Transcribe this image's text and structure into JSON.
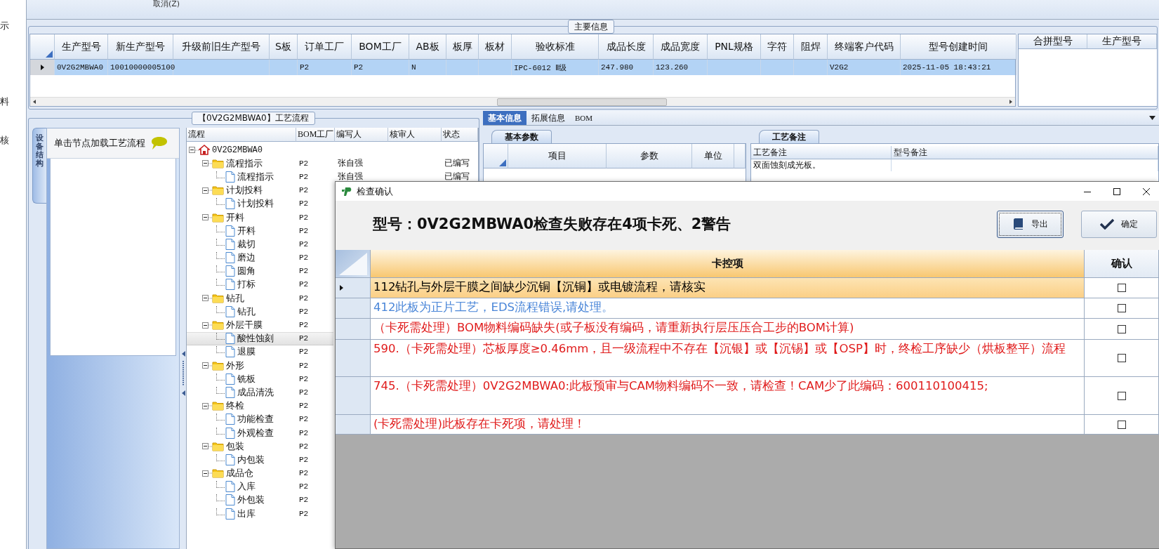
{
  "left_nav": {
    "items": [
      {
        "label": "示"
      },
      {
        "label": "料"
      },
      {
        "label": "核"
      }
    ]
  },
  "toolbar": {
    "items": [
      {
        "label": "取消(Z)"
      }
    ]
  },
  "main_info": {
    "title": "主要信息",
    "columns": [
      "生产型号",
      "新生产型号",
      "升级前旧生产型号",
      "S板",
      "订单工厂",
      "BOM工厂",
      "AB板",
      "板厚",
      "板材",
      "验收标准",
      "成品长度",
      "成品宽度",
      "PNL规格",
      "字符",
      "阻焊",
      "终端客户代码",
      "型号创建时间"
    ],
    "rows": [
      {
        "selected": true,
        "cells": [
          "0V2G2MBWA0",
          "10010000005100",
          null,
          null,
          "P2",
          "P2",
          "N",
          null,
          null,
          "IPC-6012 Ⅱ级",
          "247.980",
          "123.260",
          null,
          null,
          null,
          "V2G2",
          "2025-11-05 18:43:21"
        ]
      }
    ],
    "merge_columns": [
      "合拼型号",
      "生产型号"
    ]
  },
  "process_flow": {
    "title": "【0V2G2MBWA0】工艺流程",
    "side_tab": "设备结构",
    "hint": "单击节点加载工艺流程",
    "columns": [
      "流程",
      "BOM工厂",
      "编写人",
      "核审人",
      "状态"
    ],
    "nodes": [
      {
        "label": "0V2G2MBWA0",
        "expanded": true,
        "selected": false,
        "children": [
          {
            "label": "流程指示",
            "bom": "P2",
            "writer": "张自强",
            "status": "已编写",
            "expanded": true,
            "selected": false,
            "children": [
              {
                "label": "流程指示",
                "bom": "P2",
                "writer": "张自强",
                "status": "已编写",
                "selected": false
              }
            ]
          },
          {
            "label": "计划投料",
            "bom": "P2",
            "expanded": true,
            "selected": false,
            "children": [
              {
                "label": "计划投料",
                "bom": "P2",
                "selected": false
              }
            ]
          },
          {
            "label": "开料",
            "bom": "P2",
            "expanded": true,
            "selected": false,
            "children": [
              {
                "label": "开料",
                "bom": "P2",
                "selected": false
              },
              {
                "label": "裁切",
                "bom": "P2",
                "selected": false
              },
              {
                "label": "磨边",
                "bom": "P2",
                "selected": false
              },
              {
                "label": "圆角",
                "bom": "P2",
                "selected": false
              },
              {
                "label": "打标",
                "bom": "P2",
                "selected": false
              }
            ]
          },
          {
            "label": "钻孔",
            "bom": "P2",
            "expanded": true,
            "selected": false,
            "children": [
              {
                "label": "钻孔",
                "bom": "P2",
                "selected": false
              }
            ]
          },
          {
            "label": "外层干膜",
            "bom": "P2",
            "expanded": true,
            "selected": false,
            "children": [
              {
                "label": "酸性蚀刻",
                "bom": "P2",
                "selected": true
              },
              {
                "label": "退膜",
                "bom": "P2",
                "selected": false
              }
            ]
          },
          {
            "label": "外形",
            "bom": "P2",
            "expanded": true,
            "selected": false,
            "children": [
              {
                "label": "铣板",
                "bom": "P2",
                "selected": false
              },
              {
                "label": "成品清洗",
                "bom": "P2",
                "selected": false
              }
            ]
          },
          {
            "label": "终检",
            "bom": "P2",
            "expanded": true,
            "selected": false,
            "children": [
              {
                "label": "功能检查",
                "bom": "P2",
                "selected": false
              },
              {
                "label": "外观检查",
                "bom": "P2",
                "selected": false
              }
            ]
          },
          {
            "label": "包装",
            "bom": "P2",
            "expanded": true,
            "selected": false,
            "children": [
              {
                "label": "内包装",
                "bom": "P2",
                "selected": false
              }
            ]
          },
          {
            "label": "成品仓",
            "bom": "P2",
            "expanded": true,
            "selected": false,
            "children": [
              {
                "label": "入库",
                "bom": "P2",
                "selected": false
              },
              {
                "label": "外包装",
                "bom": "P2",
                "selected": false
              },
              {
                "label": "出库",
                "bom": "P2",
                "selected": false
              }
            ]
          }
        ]
      }
    ]
  },
  "info_panel": {
    "tabs": [
      {
        "label": "基本信息",
        "selected": true
      },
      {
        "label": "拓展信息",
        "selected": false
      },
      {
        "label": "BOM",
        "selected": false
      }
    ],
    "basic_params": {
      "title": "基本参数",
      "columns": [
        "项目",
        "参数",
        "单位"
      ]
    },
    "process_notes": {
      "title": "工艺备注",
      "columns": [
        "工艺备注",
        "型号备注"
      ],
      "rows": [
        {
          "process_note": "双面蚀刻成光板。"
        }
      ]
    }
  },
  "dialog": {
    "title": "检查确认",
    "heading": "型号：0V2G2MBWA0检查失败存在4项卡死、2警告",
    "buttons": [
      {
        "label": "导出",
        "kind": "export"
      },
      {
        "label": "确定",
        "kind": "confirm"
      }
    ],
    "columns": [
      "卡控项",
      "确认"
    ],
    "rows": [
      {
        "text": "112钻孔与外层干膜之间缺少沉铜【沉铜】或电镀流程，请核实",
        "color": "#000000",
        "checked": false,
        "selected": true
      },
      {
        "text": "412此板为正片工艺，EDS流程错误,请处理。",
        "color": "#4a86d8",
        "checked": false,
        "selected": false
      },
      {
        "text": "（卡死需处理）BOM物料编码缺失(或子板没有编码，请重新执行层压压合工步的BOM计算)",
        "color": "#e01b1b",
        "checked": false,
        "selected": false
      },
      {
        "text": "590.（卡死需处理）芯板厚度≥0.46mm，且一级流程中不存在【沉银】或【沉锡】或【OSP】时，终检工序缺少（烘板整平）流程",
        "color": "#e01b1b",
        "checked": false,
        "selected": false
      },
      {
        "text": "745.（卡死需处理）0V2G2MBWA0:此板预审与CAM物料编码不一致，请检查！CAM少了此编码：600110100415;",
        "color": "#e01b1b",
        "checked": false,
        "selected": false
      },
      {
        "text": "(卡死需处理)此板存在卡死项，请处理！",
        "color": "#e01b1b",
        "checked": false,
        "selected": false
      }
    ]
  }
}
